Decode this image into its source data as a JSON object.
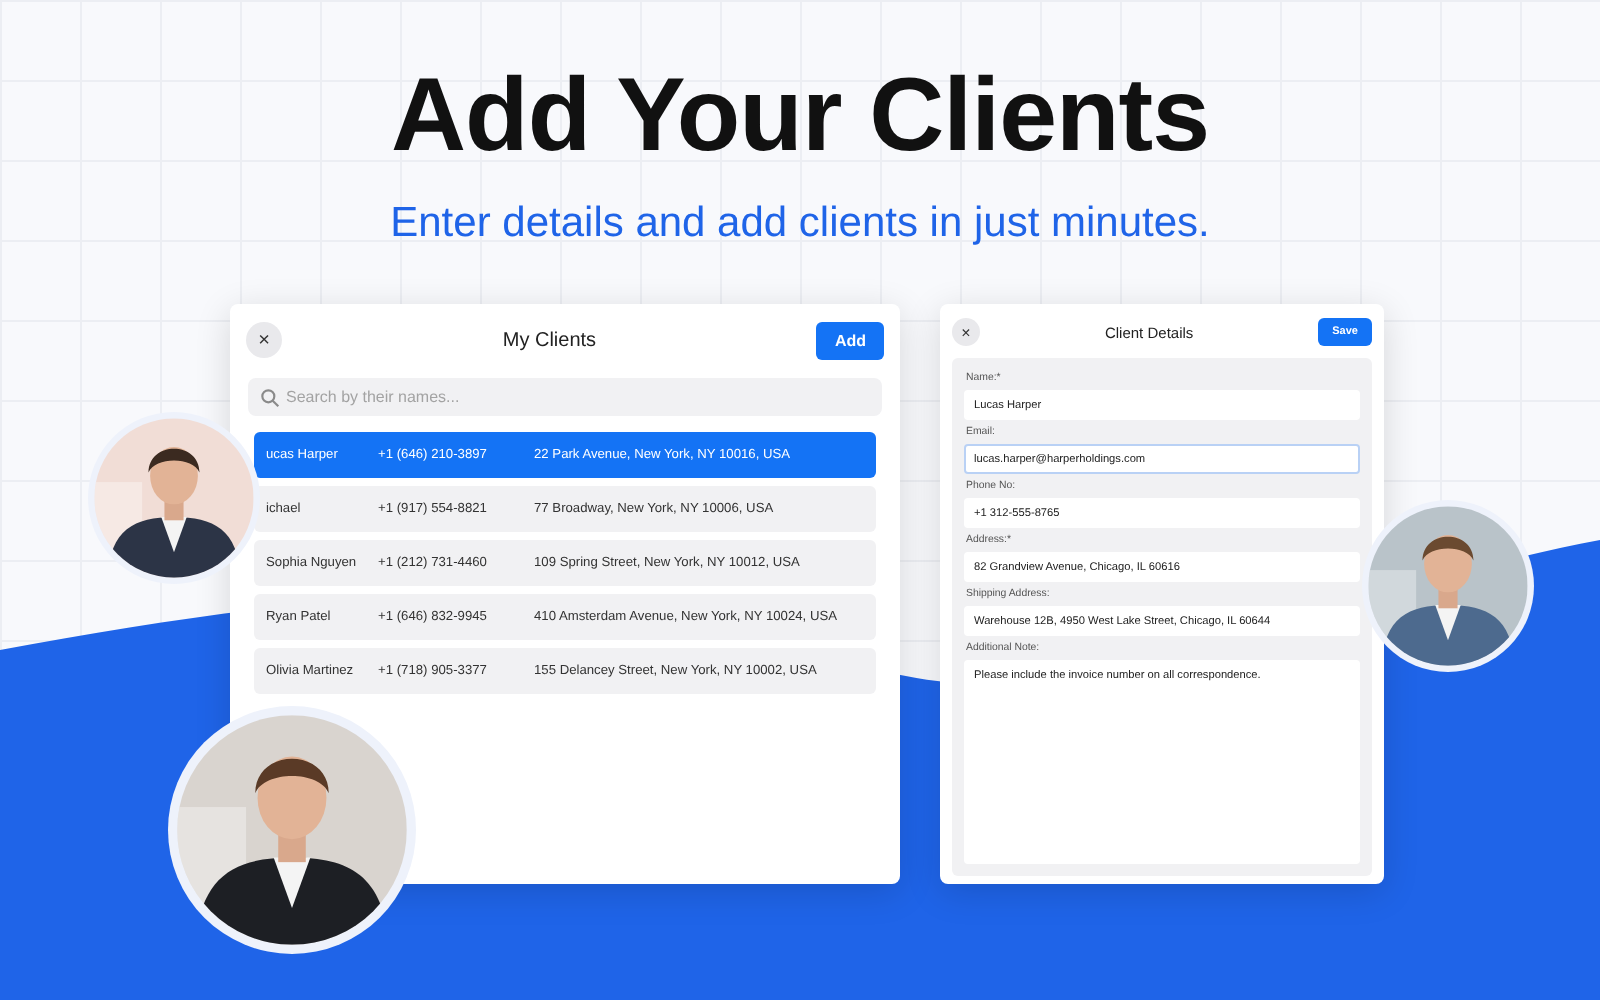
{
  "headline": "Add Your Clients",
  "subheadline": "Enter details and add clients in just minutes.",
  "clients_window": {
    "close": "×",
    "title": "My Clients",
    "add_button": "Add",
    "search": {
      "placeholder": "Search by their names..."
    },
    "rows": [
      {
        "name": "ucas Harper",
        "phone": "+1 (646) 210-3897",
        "address": "22 Park Avenue, New York, NY 10016, USA",
        "selected": true
      },
      {
        "name": "ichael",
        "phone": "+1 (917) 554-8821",
        "address": "77 Broadway, New York, NY 10006, USA",
        "selected": false
      },
      {
        "name": "Sophia Nguyen",
        "phone": "+1 (212) 731-4460",
        "address": "109 Spring Street, New York, NY 10012, USA",
        "selected": false
      },
      {
        "name": "Ryan Patel",
        "phone": "+1 (646) 832-9945",
        "address": "410 Amsterdam Avenue, New York, NY 10024, USA",
        "selected": false
      },
      {
        "name": "Olivia Martinez",
        "phone": "+1 (718) 905-3377",
        "address": "155 Delancey Street, New York, NY 10002, USA",
        "selected": false
      }
    ]
  },
  "details_window": {
    "close": "×",
    "title": "Client Details",
    "save_button": "Save",
    "fields": [
      {
        "label": "Name:*",
        "value": "Lucas Harper",
        "kind": "input",
        "focused": false
      },
      {
        "label": "Email:",
        "value": "lucas.harper@harperholdings.com",
        "kind": "input",
        "focused": true
      },
      {
        "label": "Phone No:",
        "value": "+1 312-555-8765",
        "kind": "input",
        "focused": false
      },
      {
        "label": "Address:*",
        "value": "82 Grandview Avenue, Chicago, IL 60616",
        "kind": "input",
        "focused": false
      },
      {
        "label": "Shipping Address:",
        "value": "Warehouse 12B, 4950 West Lake Street, Chicago, IL 60644",
        "kind": "input",
        "focused": false
      },
      {
        "label": "Additional Note:",
        "value": "Please include the invoice number on all correspondence.",
        "kind": "textarea",
        "focused": false
      }
    ]
  }
}
